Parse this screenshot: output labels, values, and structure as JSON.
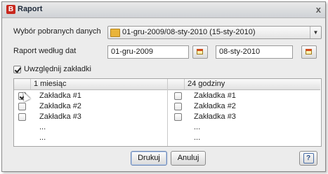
{
  "window": {
    "title": "Raport",
    "app_icon_letter": "B",
    "close_symbol": "x"
  },
  "source": {
    "label": "Wybór pobranych danych",
    "selected": "01-gru-2009/08-sty-2010 (15-sty-2010)"
  },
  "dates": {
    "label": "Raport według dat",
    "from": "01-gru-2009",
    "to": "08-sty-2010"
  },
  "include_tabs": {
    "label": "Uwzględnij zakładki",
    "checked": true
  },
  "columns": [
    {
      "header": "1 miesiąc",
      "rows": [
        {
          "label": "Zakładka #1",
          "checked": true
        },
        {
          "label": "Zakładka #2",
          "checked": false
        },
        {
          "label": "Zakładka #3",
          "checked": false
        },
        {
          "label": "...",
          "checked": null
        },
        {
          "label": "...",
          "checked": null
        }
      ]
    },
    {
      "header": "24 godziny",
      "rows": [
        {
          "label": "Zakładka #1",
          "checked": false
        },
        {
          "label": "Zakładka #2",
          "checked": false
        },
        {
          "label": "Zakładka #3",
          "checked": false
        },
        {
          "label": "...",
          "checked": null
        },
        {
          "label": "...",
          "checked": null
        }
      ]
    }
  ],
  "buttons": {
    "print": "Drukuj",
    "cancel": "Anuluj",
    "help": "?"
  },
  "icons": {
    "app": "app-logo-icon",
    "folder": "folder-icon",
    "calendar": "calendar-icon",
    "help": "help-icon",
    "dropdown": "chevron-down-icon"
  }
}
